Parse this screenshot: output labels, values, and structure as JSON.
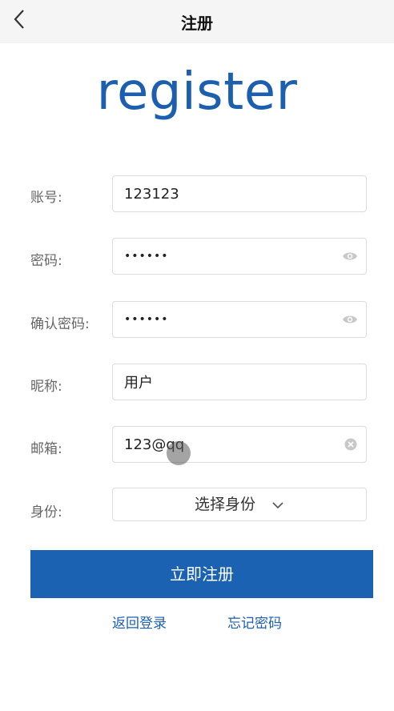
{
  "header": {
    "title": "注册"
  },
  "hero": {
    "text": "register"
  },
  "form": {
    "account": {
      "label": "账号:",
      "value": "123123"
    },
    "password": {
      "label": "密码:",
      "value": "••••••"
    },
    "confirm_password": {
      "label": "确认密码:",
      "value": "••••••"
    },
    "nickname": {
      "label": "昵称:",
      "value": "用户"
    },
    "email": {
      "label": "邮箱:",
      "value": "123@qq"
    },
    "role": {
      "label": "身份:",
      "placeholder": "选择身份"
    }
  },
  "actions": {
    "submit_label": "立即注册",
    "back_login_label": "返回登录",
    "forgot_password_label": "忘记密码"
  },
  "icons": {
    "back": "chevron-left-icon",
    "eye": "eye-icon",
    "clear": "clear-icon",
    "dropdown": "chevron-down-icon"
  },
  "colors": {
    "brand": "#1b5fae",
    "button": "#1b62b3",
    "navbar": "#f5f5f5"
  }
}
